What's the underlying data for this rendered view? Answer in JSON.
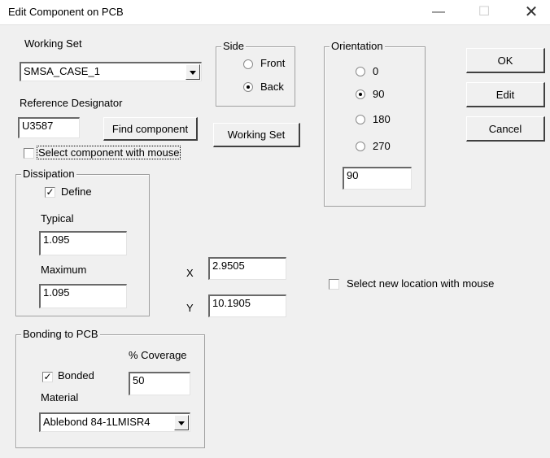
{
  "window": {
    "title": "Edit Component on PCB",
    "minimize_glyph": "—",
    "maximize_glyph": "☐",
    "close_glyph": "✕"
  },
  "working_set": {
    "label": "Working Set",
    "value": "SMSA_CASE_1",
    "button_label": "Working Set"
  },
  "reference": {
    "label": "Reference Designator",
    "value": "U3587",
    "find_button": "Find component",
    "select_mouse_label": "Select component with mouse",
    "select_mouse_checked": false
  },
  "side": {
    "title": "Side",
    "options": [
      "Front",
      "Back"
    ],
    "selected": "Back"
  },
  "orientation": {
    "title": "Orientation",
    "options": [
      "0",
      "90",
      "180",
      "270"
    ],
    "selected": "90",
    "value": "90"
  },
  "buttons": {
    "ok": "OK",
    "edit": "Edit",
    "cancel": "Cancel"
  },
  "dissipation": {
    "title": "Dissipation",
    "define_label": "Define",
    "define_checked": true,
    "typical_label": "Typical",
    "typical_value": "1.095",
    "maximum_label": "Maximum",
    "maximum_value": "1.095"
  },
  "location": {
    "x_label": "X",
    "x_value": "2.9505",
    "y_label": "Y",
    "y_value": "10.1905",
    "select_new_label": "Select new location with mouse",
    "select_new_checked": false
  },
  "bonding": {
    "title": "Bonding to PCB",
    "coverage_label": "% Coverage",
    "coverage_value": "50",
    "bonded_label": "Bonded",
    "bonded_checked": true,
    "material_label": "Material",
    "material_value": "Ablebond 84-1LMISR4"
  },
  "glyphs": {
    "check_mark": "✓"
  }
}
